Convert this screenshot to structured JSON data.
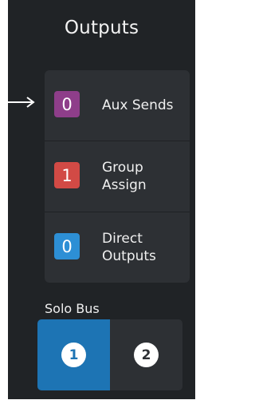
{
  "panel": {
    "title": "Outputs",
    "background": "#202326"
  },
  "outputs": [
    {
      "label": "Aux Sends",
      "count": "0",
      "color": "#8e3e8a",
      "icon": "arrow-right-icon"
    },
    {
      "label": "Group\nAssign",
      "count": "1",
      "color": "#d24a45"
    },
    {
      "label": "Direct\nOutputs",
      "count": "0",
      "color": "#2d8fd5"
    }
  ],
  "solo_bus": {
    "label": "Solo Bus",
    "options": [
      {
        "label": "1",
        "selected": true,
        "color": "#1d74b4"
      },
      {
        "label": "2",
        "selected": false,
        "color": "#2d3034"
      }
    ]
  }
}
